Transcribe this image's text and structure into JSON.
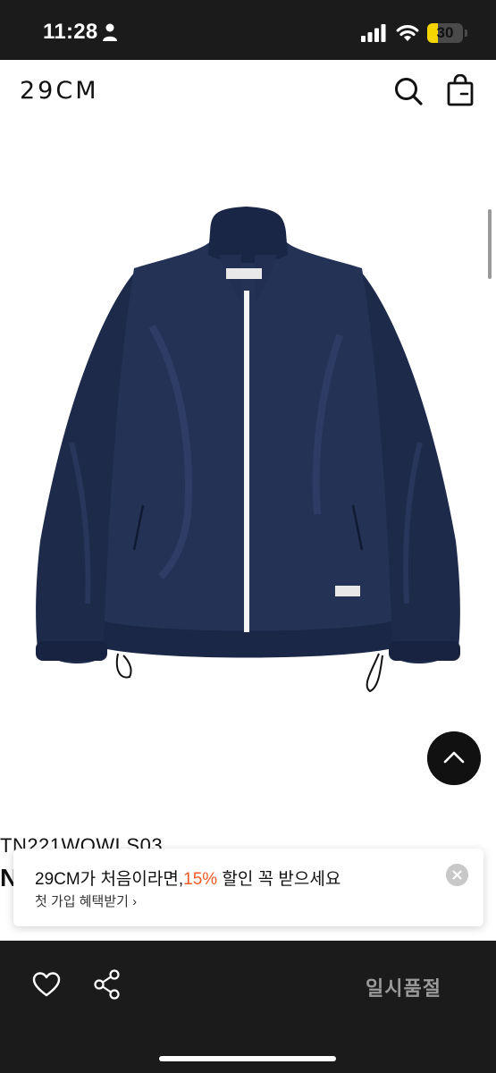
{
  "status_bar": {
    "time": "11:28",
    "battery_level": 30,
    "battery_label": "30",
    "colors": {
      "background": "#1b1b1b",
      "battery_fill": "#f5d500"
    }
  },
  "header": {
    "logo": "29CM",
    "icons": [
      "search-icon",
      "shopping-bag-icon"
    ]
  },
  "product": {
    "image_description_icon": "navy-track-jacket",
    "code": "TN221WOWLS03",
    "name": "N"
  },
  "promo_banner": {
    "title_prefix": "29CM가 처음이라면,",
    "title_accent": "15%",
    "title_suffix": " 할인 꼭 받으세요",
    "subtitle": "첫 가입 혜택받기 ›",
    "accent_color": "#f15a24"
  },
  "bottom_bar": {
    "status_label": "일시품절",
    "icons": [
      "heart-icon",
      "share-icon"
    ]
  }
}
